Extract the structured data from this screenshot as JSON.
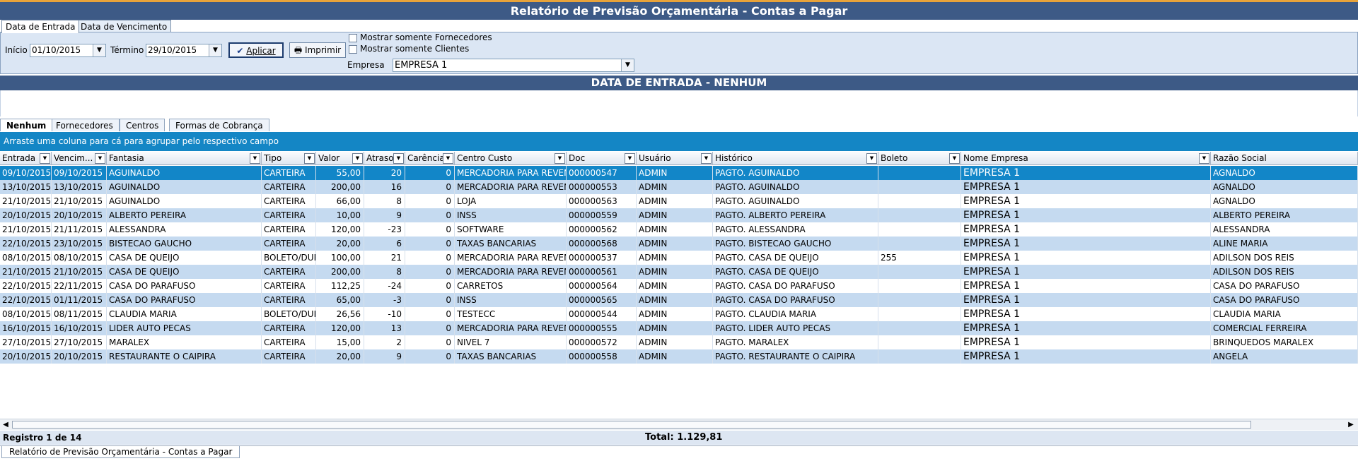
{
  "window": {
    "title": "Relatório de Previsão Orçamentária - Contas a Pagar"
  },
  "top_tabs": [
    {
      "label": "Data de Entrada",
      "active": true
    },
    {
      "label": "Data de Vencimento",
      "active": false
    }
  ],
  "filters": {
    "inicio_label": "Início",
    "inicio_value": "01/10/2015",
    "termino_label": "Término",
    "termino_value": "29/10/2015",
    "aplicar_label": "Aplicar",
    "imprimir_label": "Imprimir",
    "chk_fornecedores_label": "Mostrar somente Fornecedores",
    "chk_clientes_label": "Mostrar somente Clientes",
    "empresa_label": "Empresa",
    "empresa_value": "EMPRESA 1"
  },
  "section_header": "DATA DE ENTRADA - NENHUM",
  "group_tabs": [
    {
      "label": "Nenhum",
      "active": true
    },
    {
      "label": "Fornecedores",
      "active": false
    },
    {
      "label": "Centros",
      "active": false
    },
    {
      "label": "Formas de Cobrança",
      "active": false
    }
  ],
  "group_hint": "Arraste uma coluna para cá para agrupar pelo respectivo campo",
  "columns": [
    "Entrada",
    "Vencim...",
    "Fantasia",
    "Tipo",
    "Valor",
    "Atraso",
    "Carência",
    "Centro Custo",
    "Doc",
    "Usuário",
    "Histórico",
    "Boleto",
    "Nome Empresa",
    "Razão Social"
  ],
  "rows": [
    [
      "09/10/2015",
      "09/10/2015",
      "AGUINALDO",
      "CARTEIRA",
      "55,00",
      "20",
      "0",
      "MERCADORIA PARA REVENDA",
      "000000547",
      "ADMIN",
      "PAGTO. AGUINALDO",
      "",
      "EMPRESA 1",
      "AGNALDO"
    ],
    [
      "13/10/2015",
      "13/10/2015",
      "AGUINALDO",
      "CARTEIRA",
      "200,00",
      "16",
      "0",
      "MERCADORIA PARA REVENDA",
      "000000553",
      "ADMIN",
      "PAGTO. AGUINALDO",
      "",
      "EMPRESA 1",
      "AGNALDO"
    ],
    [
      "21/10/2015",
      "21/10/2015",
      "AGUINALDO",
      "CARTEIRA",
      "66,00",
      "8",
      "0",
      "LOJA",
      "000000563",
      "ADMIN",
      "PAGTO. AGUINALDO",
      "",
      "EMPRESA 1",
      "AGNALDO"
    ],
    [
      "20/10/2015",
      "20/10/2015",
      "ALBERTO PEREIRA",
      "CARTEIRA",
      "10,00",
      "9",
      "0",
      "INSS",
      "000000559",
      "ADMIN",
      "PAGTO. ALBERTO PEREIRA",
      "",
      "EMPRESA 1",
      "ALBERTO PEREIRA"
    ],
    [
      "21/10/2015",
      "21/11/2015",
      "ALESSANDRA",
      "CARTEIRA",
      "120,00",
      "-23",
      "0",
      "SOFTWARE",
      "000000562",
      "ADMIN",
      "PAGTO. ALESSANDRA",
      "",
      "EMPRESA 1",
      "ALESSANDRA"
    ],
    [
      "22/10/2015",
      "23/10/2015",
      "BISTECAO GAUCHO",
      "CARTEIRA",
      "20,00",
      "6",
      "0",
      "TAXAS BANCARIAS",
      "000000568",
      "ADMIN",
      "PAGTO. BISTECAO GAUCHO",
      "",
      "EMPRESA 1",
      "ALINE MARIA"
    ],
    [
      "08/10/2015",
      "08/10/2015",
      "CASA DE QUEIJO",
      "BOLETO/DUPLICATA",
      "100,00",
      "21",
      "0",
      "MERCADORIA PARA REVENDA",
      "000000537",
      "ADMIN",
      "PAGTO. CASA DE QUEIJO",
      "255",
      "EMPRESA 1",
      "ADILSON DOS REIS"
    ],
    [
      "21/10/2015",
      "21/10/2015",
      "CASA DE QUEIJO",
      "CARTEIRA",
      "200,00",
      "8",
      "0",
      "MERCADORIA PARA REVENDA",
      "000000561",
      "ADMIN",
      "PAGTO. CASA DE QUEIJO",
      "",
      "EMPRESA 1",
      "ADILSON DOS REIS"
    ],
    [
      "22/10/2015",
      "22/11/2015",
      "CASA DO PARAFUSO",
      "CARTEIRA",
      "112,25",
      "-24",
      "0",
      "CARRETOS",
      "000000564",
      "ADMIN",
      "PAGTO. CASA DO PARAFUSO",
      "",
      "EMPRESA 1",
      "CASA DO PARAFUSO"
    ],
    [
      "22/10/2015",
      "01/11/2015",
      "CASA DO PARAFUSO",
      "CARTEIRA",
      "65,00",
      "-3",
      "0",
      "INSS",
      "000000565",
      "ADMIN",
      "PAGTO. CASA DO PARAFUSO",
      "",
      "EMPRESA 1",
      "CASA DO PARAFUSO"
    ],
    [
      "08/10/2015",
      "08/11/2015",
      "CLAUDIA MARIA",
      "BOLETO/DUPLICATA",
      "26,56",
      "-10",
      "0",
      "TESTECC",
      "000000544",
      "ADMIN",
      "PAGTO. CLAUDIA MARIA",
      "",
      "EMPRESA 1",
      "CLAUDIA MARIA"
    ],
    [
      "16/10/2015",
      "16/10/2015",
      "LIDER AUTO PECAS",
      "CARTEIRA",
      "120,00",
      "13",
      "0",
      "MERCADORIA PARA REVENDA",
      "000000555",
      "ADMIN",
      "PAGTO. LIDER AUTO PECAS",
      "",
      "EMPRESA 1",
      "COMERCIAL FERREIRA"
    ],
    [
      "27/10/2015",
      "27/10/2015",
      "MARALEX",
      "CARTEIRA",
      "15,00",
      "2",
      "0",
      "NIVEL 7",
      "000000572",
      "ADMIN",
      "PAGTO. MARALEX",
      "",
      "EMPRESA 1",
      "BRINQUEDOS MARALEX"
    ],
    [
      "20/10/2015",
      "20/10/2015",
      "RESTAURANTE O CAIPIRA",
      "CARTEIRA",
      "20,00",
      "9",
      "0",
      "TAXAS BANCARIAS",
      "000000558",
      "ADMIN",
      "PAGTO. RESTAURANTE O CAIPIRA",
      "",
      "EMPRESA 1",
      "ANGELA"
    ]
  ],
  "status": {
    "registro": "Registro 1 de 14",
    "total": "Total: 1.129,81"
  },
  "bottom_tab": "Relatório de Previsão Orçamentária - Contas a Pagar",
  "colors": {
    "header_blue": "#3d5a86",
    "group_bar": "#1486c5",
    "row_alt": "#c5daf0",
    "row_selected": "#1286c8",
    "title_accent": "#e8a33a"
  }
}
